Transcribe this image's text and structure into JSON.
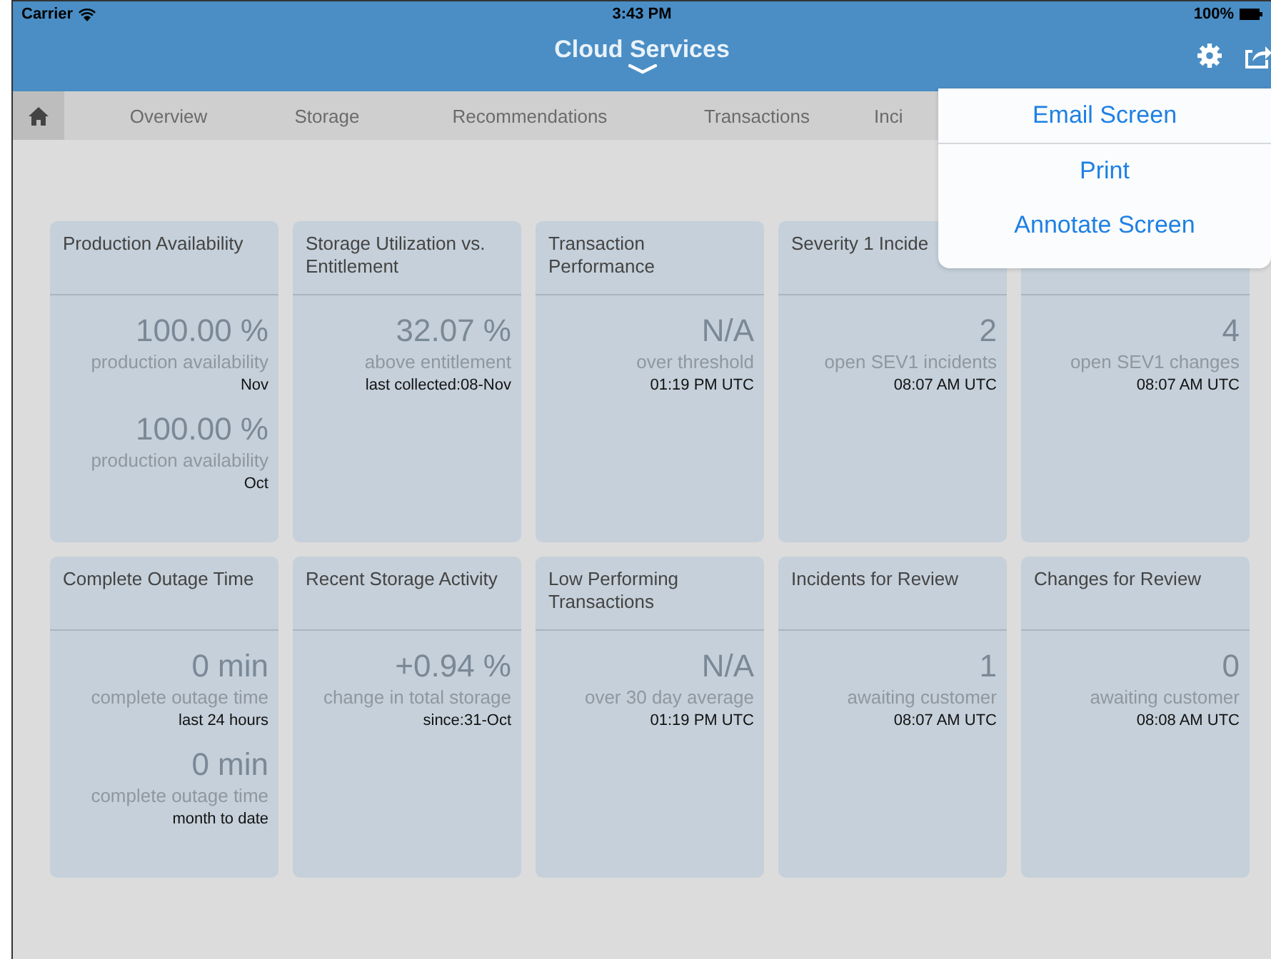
{
  "status_bar": {
    "carrier": "Carrier",
    "time": "3:43 PM",
    "battery": "100%"
  },
  "header": {
    "title": "Cloud Services"
  },
  "tabs": [
    {
      "kind": "home",
      "selected": true
    },
    {
      "kind": "text",
      "label": "Overview",
      "selected": false
    },
    {
      "kind": "text",
      "label": "Storage",
      "selected": false
    },
    {
      "kind": "text",
      "label": "Recommendations",
      "selected": false
    },
    {
      "kind": "text",
      "label": "Transactions",
      "selected": false
    },
    {
      "kind": "text",
      "label": "Inci",
      "selected": false
    }
  ],
  "cards": [
    {
      "title": "Production Availability",
      "metrics": [
        {
          "value": "100.00 %",
          "label": "production availability",
          "note": "Nov"
        },
        {
          "value": "100.00 %",
          "label": "production availability",
          "note": "Oct"
        }
      ]
    },
    {
      "title": "Storage Utilization vs. Entitlement",
      "metrics": [
        {
          "value": "32.07 %",
          "label": "above entitlement",
          "note": "last collected:08-Nov"
        }
      ]
    },
    {
      "title": "Transaction Performance",
      "metrics": [
        {
          "value": "N/A",
          "label": "over threshold",
          "note": "01:19 PM UTC"
        }
      ]
    },
    {
      "title": "Severity 1 Incide",
      "metrics": [
        {
          "value": "2",
          "label": "open SEV1 incidents",
          "note": "08:07 AM UTC"
        }
      ]
    },
    {
      "metrics": [
        {
          "value": "4",
          "label": "open SEV1 changes",
          "note": "08:07 AM UTC"
        }
      ]
    },
    {
      "title": "Complete Outage Time",
      "metrics": [
        {
          "value": "0 min",
          "label": "complete outage time",
          "note": "last 24 hours"
        },
        {
          "value": "0 min",
          "label": "complete outage time",
          "note": "month to date"
        }
      ]
    },
    {
      "title": "Recent Storage Activity",
      "metrics": [
        {
          "value": "+0.94 %",
          "label": "change in total storage",
          "note": "since:31-Oct"
        }
      ]
    },
    {
      "title": "Low Performing Transactions",
      "metrics": [
        {
          "value": "N/A",
          "label": "over 30 day average",
          "note": "01:19 PM UTC"
        }
      ]
    },
    {
      "title": "Incidents for Review",
      "metrics": [
        {
          "value": "1",
          "label": "awaiting customer",
          "note": "08:07 AM UTC"
        }
      ]
    },
    {
      "title": "Changes for Review",
      "metrics": [
        {
          "value": "0",
          "label": "awaiting customer",
          "note": "08:08 AM UTC"
        }
      ]
    }
  ],
  "share_menu": {
    "items": [
      "Email Screen",
      "Print",
      "Annotate Screen"
    ]
  }
}
